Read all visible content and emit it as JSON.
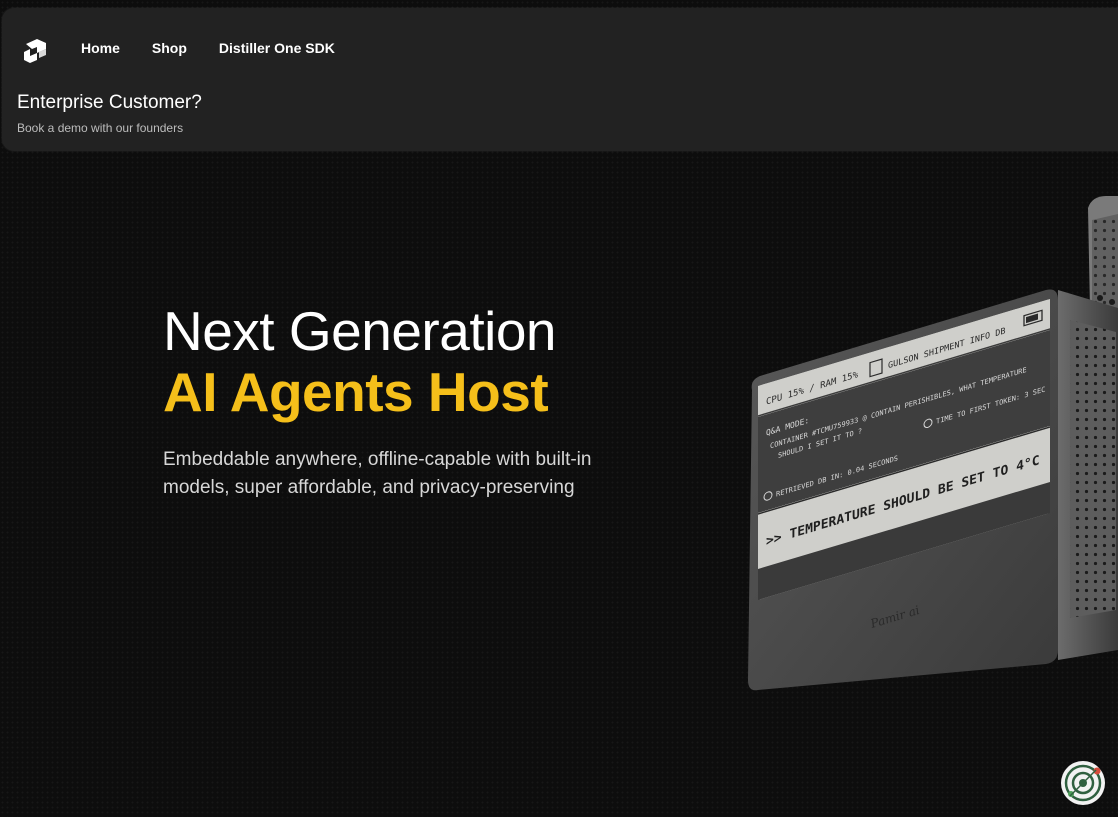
{
  "header": {
    "logo_icon": "distiller-logo-icon",
    "nav": [
      {
        "label": "Home"
      },
      {
        "label": "Shop"
      },
      {
        "label": "Distiller One SDK"
      }
    ],
    "promo": {
      "title": "Enterprise Customer?",
      "subtitle": "Book a demo with our founders"
    }
  },
  "hero": {
    "line1": "Next Generation",
    "line2": "AI Agents Host",
    "description": "Embeddable anywhere, offline-capable with built-in models, super affordable, and privacy-preserving",
    "accent_color": "#f5bf1a"
  },
  "device": {
    "stats": "CPU 15% / RAM 15%",
    "db_name": "GULSON SHIPMENT INFO DB",
    "mode": "Q&A MODE:",
    "question_line1": "CONTAINER #TCMU759933 @ CONTAIN PERISHIBLES, WHAT TEMPERATURE",
    "question_line2": "SHOULD I SET IT TO ?",
    "ttft": "TIME TO FIRST TOKEN: 3 SEC",
    "retrieved": "RETRIEVED DB IN: 0.04 SECONDS",
    "answer": ">> TEMPERATURE SHOULD BE SET TO 4°C",
    "brand": "Pamir ai"
  },
  "widget": {
    "icon": "orbit-assistant-icon"
  }
}
